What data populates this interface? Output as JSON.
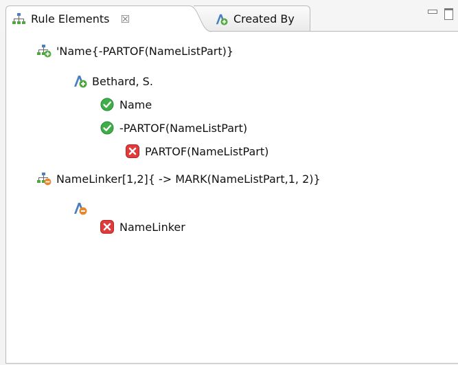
{
  "tabs": [
    {
      "label": "Rule Elements",
      "close_glyph": "☒",
      "icon": "tree-icon",
      "active": true
    },
    {
      "label": "Created By",
      "icon": "annotation-icon",
      "active": false
    }
  ],
  "window_controls": [
    "minimize-icon",
    "maximize-icon"
  ],
  "tree": [
    {
      "label": "'Name{-PARTOF(NameListPart)}",
      "icon": "rule-matched-icon",
      "level": 0
    },
    {
      "label": "Bethard, S.",
      "icon": "annotation-matched-icon",
      "level": 1
    },
    {
      "label": "Name",
      "icon": "check-icon",
      "level": 2
    },
    {
      "label": "-PARTOF(NameListPart)",
      "icon": "check-icon",
      "level": 2
    },
    {
      "label": "PARTOF(NameListPart)",
      "icon": "error-icon",
      "level": 3
    },
    {
      "label": "NameLinker[1,2]{ -> MARK(NameListPart,1, 2)}",
      "icon": "rule-failed-icon",
      "level": 0
    },
    {
      "label": "",
      "icon": "annotation-failed-icon",
      "level": 1
    },
    {
      "label": "NameLinker",
      "icon": "error-icon",
      "level": 2
    }
  ],
  "colors": {
    "success": "#3fae49",
    "error": "#e03a3a",
    "rule_blue": "#4a7fc0",
    "rule_green": "#4fa83d",
    "warning_orange": "#e4892f"
  }
}
